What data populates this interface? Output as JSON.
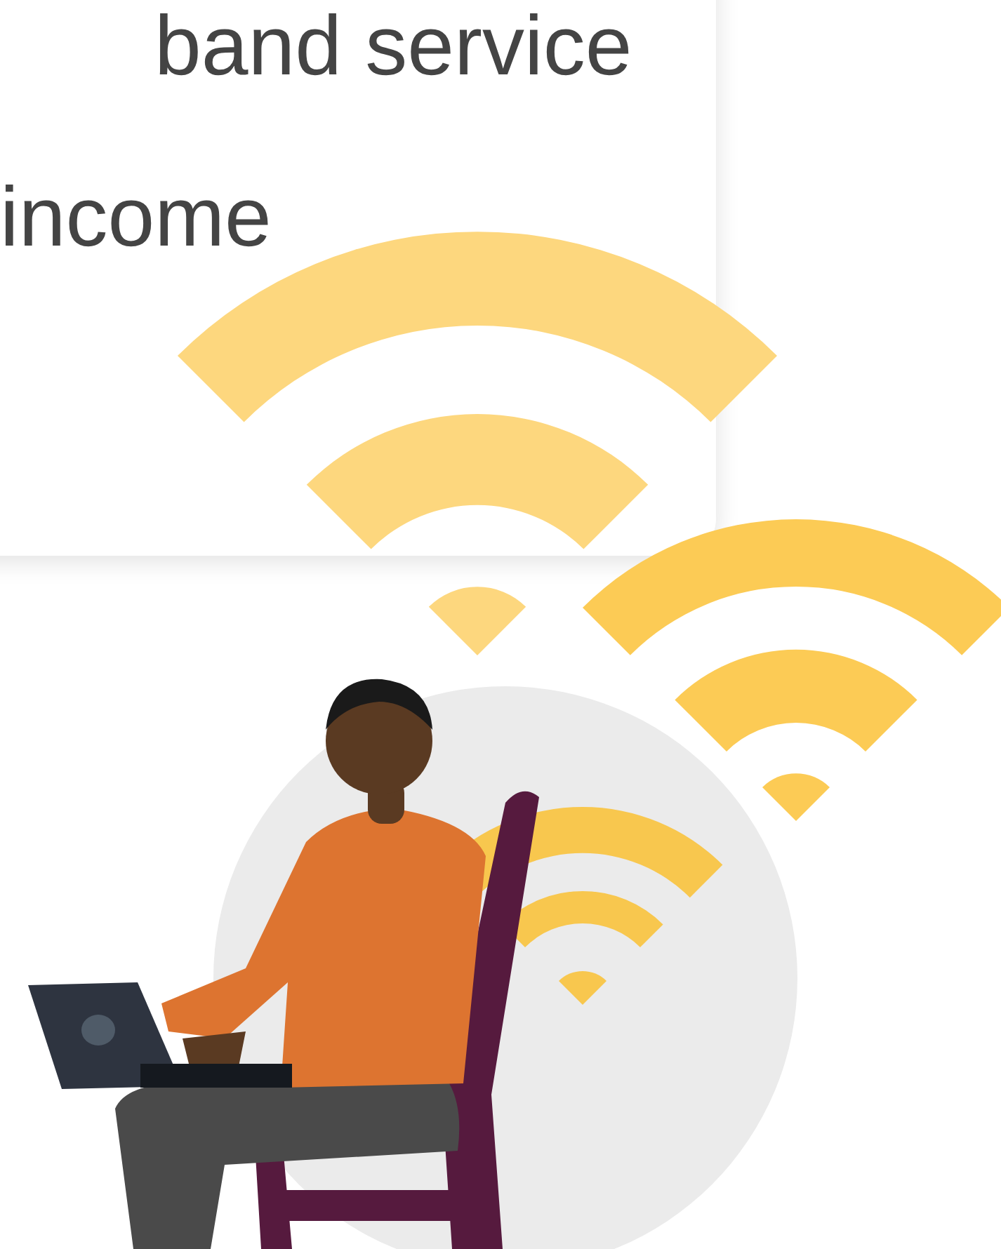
{
  "card": {
    "lines": [
      "band service",
      "income"
    ]
  }
}
